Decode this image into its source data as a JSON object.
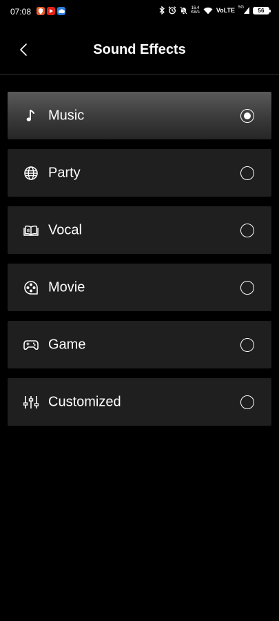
{
  "status_bar": {
    "time": "07:08",
    "app_icons": [
      "brave-icon",
      "youtube-icon",
      "cloud-icon"
    ],
    "network_speed_top": "16.4",
    "network_speed_bottom": "KB/s",
    "volte_label": "VoLTE",
    "signal_label": "5G",
    "battery_level": "56"
  },
  "header": {
    "title": "Sound Effects",
    "back_icon": "chevron-left-icon"
  },
  "effects": [
    {
      "label": "Music",
      "icon": "music-note-icon",
      "selected": true
    },
    {
      "label": "Party",
      "icon": "globe-grid-icon",
      "selected": false
    },
    {
      "label": "Vocal",
      "icon": "book-icon",
      "selected": false
    },
    {
      "label": "Movie",
      "icon": "film-reel-icon",
      "selected": false
    },
    {
      "label": "Game",
      "icon": "gamepad-icon",
      "selected": false
    },
    {
      "label": "Customized",
      "icon": "sliders-icon",
      "selected": false
    }
  ],
  "colors": {
    "background": "#000000",
    "item_background": "#1f1f1f",
    "selected_top": "#5a5a5a",
    "text": "#ffffff"
  }
}
